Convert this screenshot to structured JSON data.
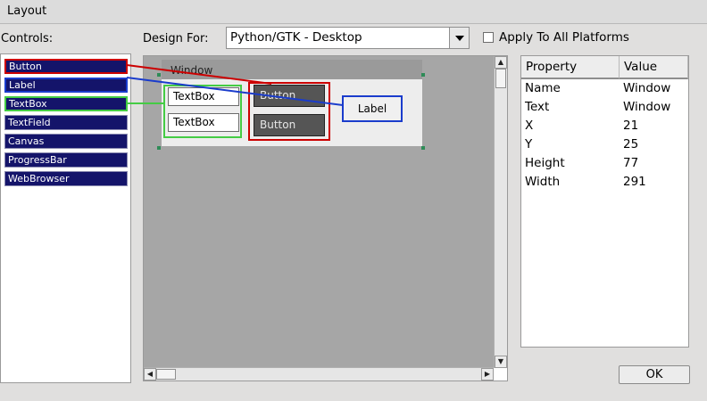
{
  "window": {
    "title": "Layout"
  },
  "controls": {
    "label": "Controls:",
    "items": [
      {
        "label": "Button",
        "border": "#cc0000"
      },
      {
        "label": "Label",
        "border": "#1a3ccc"
      },
      {
        "label": "TextBox",
        "border": "#44cc44"
      },
      {
        "label": "TextField"
      },
      {
        "label": "Canvas"
      },
      {
        "label": "ProgressBar"
      },
      {
        "label": "WebBrowser"
      }
    ]
  },
  "design_for": {
    "label": "Design For:",
    "selected": "Python/GTK - Desktop"
  },
  "apply_all": {
    "label": "Apply To All Platforms",
    "checked": false
  },
  "canvas": {
    "window_title": "Window",
    "textboxes": [
      "TextBox",
      "TextBox"
    ],
    "buttons": [
      "Button",
      "Button"
    ],
    "label": "Label"
  },
  "properties": {
    "headers": [
      "Property",
      "Value"
    ],
    "rows": [
      {
        "property": "Name",
        "value": "Window"
      },
      {
        "property": "Text",
        "value": "Window"
      },
      {
        "property": "X",
        "value": "21"
      },
      {
        "property": "Y",
        "value": "25"
      },
      {
        "property": "Height",
        "value": "77"
      },
      {
        "property": "Width",
        "value": "291"
      }
    ]
  },
  "ok": {
    "label": "OK"
  },
  "colors": {
    "button_link": "#cc0000",
    "label_link": "#1a3ccc",
    "textbox_link": "#44cc44"
  }
}
